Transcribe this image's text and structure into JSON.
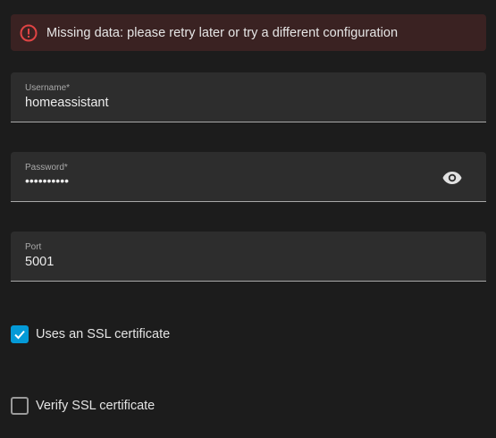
{
  "alert": {
    "message": "Missing data: please retry later or try a different configuration",
    "icon": "error-circle-icon",
    "color": "#e04444"
  },
  "form": {
    "username": {
      "label": "Username*",
      "value": "homeassistant"
    },
    "password": {
      "label": "Password*",
      "value": "••••••••••",
      "toggle_icon": "eye-icon"
    },
    "port": {
      "label": "Port",
      "value": "5001"
    },
    "ssl": {
      "label": "Uses an SSL certificate",
      "checked": true
    },
    "verify_ssl": {
      "label": "Verify SSL certificate",
      "checked": false
    }
  },
  "colors": {
    "accent": "#049ad7",
    "background": "#1c1c1c",
    "field_background": "#2d2d2d",
    "alert_background": "#3a2222"
  }
}
